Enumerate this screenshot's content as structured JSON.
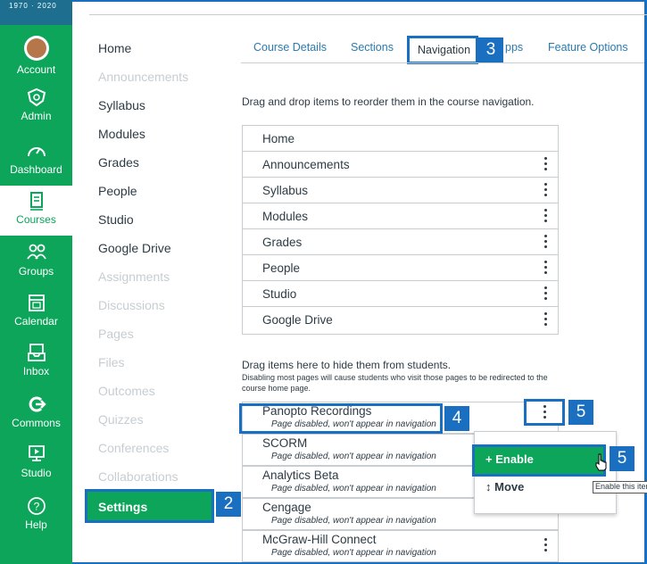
{
  "global_nav": {
    "logo_text": "1970 · 2020",
    "items": [
      {
        "label": "Account"
      },
      {
        "label": "Admin"
      },
      {
        "label": "Dashboard"
      },
      {
        "label": "Courses"
      },
      {
        "label": "Groups"
      },
      {
        "label": "Calendar"
      },
      {
        "label": "Inbox"
      },
      {
        "label": "Commons"
      },
      {
        "label": "Studio"
      },
      {
        "label": "Help"
      }
    ]
  },
  "course_nav": {
    "items": [
      {
        "label": "Home",
        "enabled": true
      },
      {
        "label": "Announcements",
        "enabled": false
      },
      {
        "label": "Syllabus",
        "enabled": true
      },
      {
        "label": "Modules",
        "enabled": true
      },
      {
        "label": "Grades",
        "enabled": true
      },
      {
        "label": "People",
        "enabled": true
      },
      {
        "label": "Studio",
        "enabled": true
      },
      {
        "label": "Google Drive",
        "enabled": true
      },
      {
        "label": "Assignments",
        "enabled": false
      },
      {
        "label": "Discussions",
        "enabled": false
      },
      {
        "label": "Pages",
        "enabled": false
      },
      {
        "label": "Files",
        "enabled": false
      },
      {
        "label": "Outcomes",
        "enabled": false
      },
      {
        "label": "Quizzes",
        "enabled": false
      },
      {
        "label": "Conferences",
        "enabled": false
      },
      {
        "label": "Collaborations",
        "enabled": false
      }
    ],
    "settings_label": "Settings"
  },
  "tabs": {
    "course_details": "Course Details",
    "sections": "Sections",
    "navigation": "Navigation",
    "apps_suffix": "pps",
    "feature_options": "Feature Options"
  },
  "enabled_section": {
    "instruction": "Drag and drop items to reorder them in the course navigation.",
    "items": [
      "Home",
      "Announcements",
      "Syllabus",
      "Modules",
      "Grades",
      "People",
      "Studio",
      "Google Drive"
    ]
  },
  "disabled_section": {
    "instruction": "Drag items here to hide them from students.",
    "note": "Disabling most pages will cause students who visit those pages to be redirected to the course home page.",
    "disabled_text": "Page disabled, won't appear in navigation",
    "items": [
      "Panopto Recordings",
      "SCORM",
      "Analytics Beta",
      "Cengage",
      "McGraw-Hill Connect"
    ]
  },
  "menu": {
    "enable_label": "+ Enable",
    "move_label": "↕ Move",
    "tooltip": "Enable this item"
  },
  "steps": {
    "settings": "2",
    "navigation_tab": "3",
    "panopto": "4",
    "kebab": "5",
    "enable": "5"
  },
  "colors": {
    "brand_green": "#0ca55a",
    "highlight_blue": "#1a6fc0",
    "link_blue": "#2a7ab0"
  }
}
